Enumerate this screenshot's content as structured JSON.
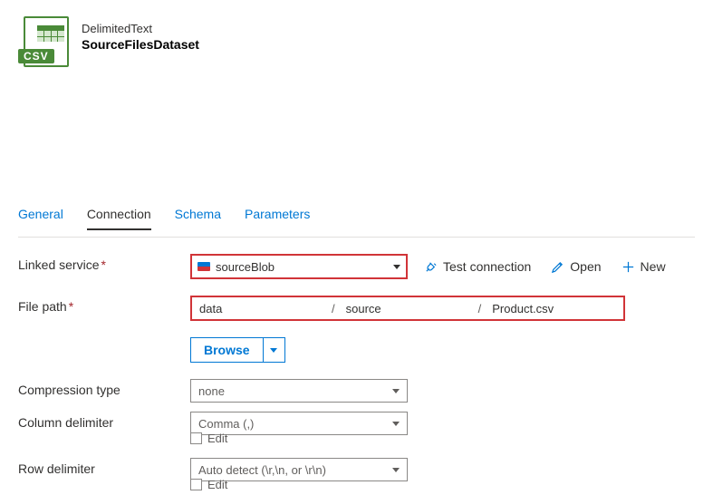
{
  "header": {
    "subtitle": "DelimitedText",
    "title": "SourceFilesDataset",
    "icon_label": "CSV"
  },
  "tabs": {
    "general": "General",
    "connection": "Connection",
    "schema": "Schema",
    "parameters": "Parameters"
  },
  "labels": {
    "linked_service": "Linked service",
    "file_path": "File path",
    "compression_type": "Compression type",
    "column_delimiter": "Column delimiter",
    "row_delimiter": "Row delimiter"
  },
  "linked_service": {
    "value": "sourceBlob",
    "actions": {
      "test": "Test connection",
      "open": "Open",
      "new": "New"
    }
  },
  "file_path": {
    "container": "data",
    "directory": "source",
    "file": "Product.csv",
    "browse": "Browse"
  },
  "compression": {
    "value": "none"
  },
  "column_delimiter": {
    "value": "Comma (,)",
    "edit": "Edit"
  },
  "row_delimiter": {
    "value": "Auto detect (\\r,\\n, or \\r\\n)",
    "edit": "Edit"
  }
}
